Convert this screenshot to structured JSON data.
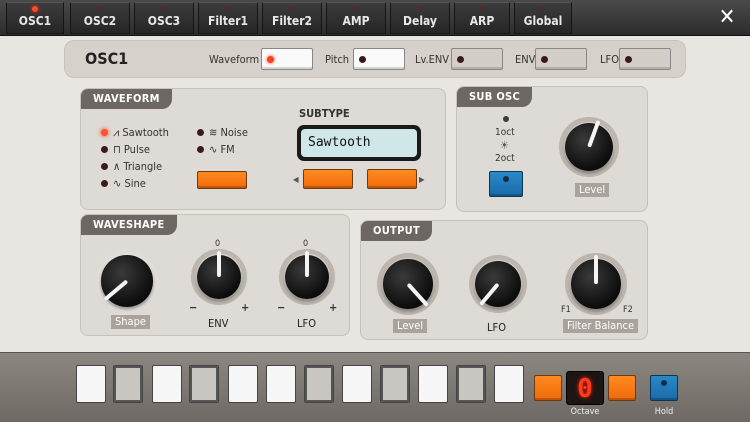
{
  "tabs": [
    {
      "label": "OSC1",
      "active": true
    },
    {
      "label": "OSC2",
      "active": false
    },
    {
      "label": "OSC3",
      "active": false
    },
    {
      "label": "Filter1",
      "active": false
    },
    {
      "label": "Filter2",
      "active": false
    },
    {
      "label": "AMP",
      "active": false
    },
    {
      "label": "Delay",
      "active": false
    },
    {
      "label": "ARP",
      "active": false
    },
    {
      "label": "Global",
      "active": false
    }
  ],
  "close_icon": "close-icon",
  "header": {
    "title": "OSC1",
    "waveform_label": "Waveform",
    "pitch_label": "Pitch",
    "lvenv_label": "Lv.ENV",
    "env_label": "ENV",
    "lfo_label": "LFO"
  },
  "waveform": {
    "title": "WAVEFORM",
    "items": [
      {
        "label": "Sawtooth",
        "selected": true
      },
      {
        "label": "Pulse",
        "selected": false
      },
      {
        "label": "Triangle",
        "selected": false
      },
      {
        "label": "Sine",
        "selected": false
      },
      {
        "label": "Noise",
        "selected": false
      },
      {
        "label": "FM",
        "selected": false
      }
    ],
    "subtype_label": "SUBTYPE",
    "subtype_value": "Sawtooth"
  },
  "sub_osc": {
    "title": "SUB OSC",
    "oct1": "1oct",
    "oct2": "2oct",
    "level_label": "Level"
  },
  "waveshape": {
    "title": "WAVESHAPE",
    "shape_label": "Shape",
    "env_label": "ENV",
    "lfo_label": "LFO",
    "zero": "0",
    "minus": "−",
    "plus": "+"
  },
  "output": {
    "title": "OUTPUT",
    "level_label": "Level",
    "lfo_label": "LFO",
    "filter_balance_label": "Filter Balance",
    "f1": "F1",
    "f2": "F2"
  },
  "keyboard": {
    "octave_value": "0",
    "octave_label": "Octave",
    "hold_label": "Hold"
  },
  "colors": {
    "accent_orange": "#f47a14",
    "accent_blue": "#1f7cbc",
    "led_red": "#ff4020"
  }
}
